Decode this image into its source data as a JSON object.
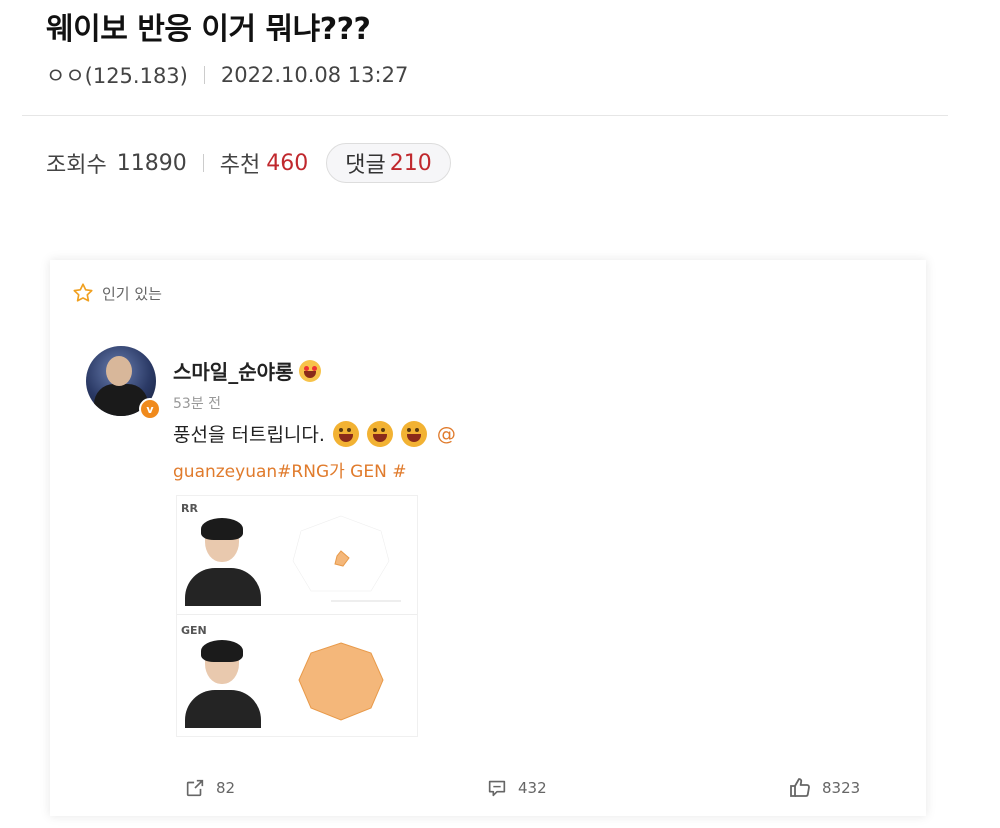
{
  "post": {
    "title": "웨이보 반응 이거 뭐냐???",
    "author": "ㅇㅇ(125.183)",
    "datetime": "2022.10.08 13:27",
    "views_label": "조회수",
    "views": "11890",
    "recommend_label": "추천",
    "recommend": "460",
    "comments_label": "댓글",
    "comments": "210"
  },
  "weibo": {
    "popular_label": "인기 있는",
    "username": "스마일_순야롱",
    "time": "53분 전",
    "text": "풍선을 터트립니다.",
    "mention": "@",
    "text2": "guanzeyuan#RNG가 GEN #",
    "image": {
      "team1_logo": "RR",
      "team2_logo": "GEN"
    },
    "actions": {
      "share_count": "82",
      "comment_count": "432",
      "like_count": "8323"
    }
  },
  "colors": {
    "accent_red": "#c0282d",
    "weibo_orange": "#e07b2c",
    "radar_fill": "#f4b77a"
  }
}
